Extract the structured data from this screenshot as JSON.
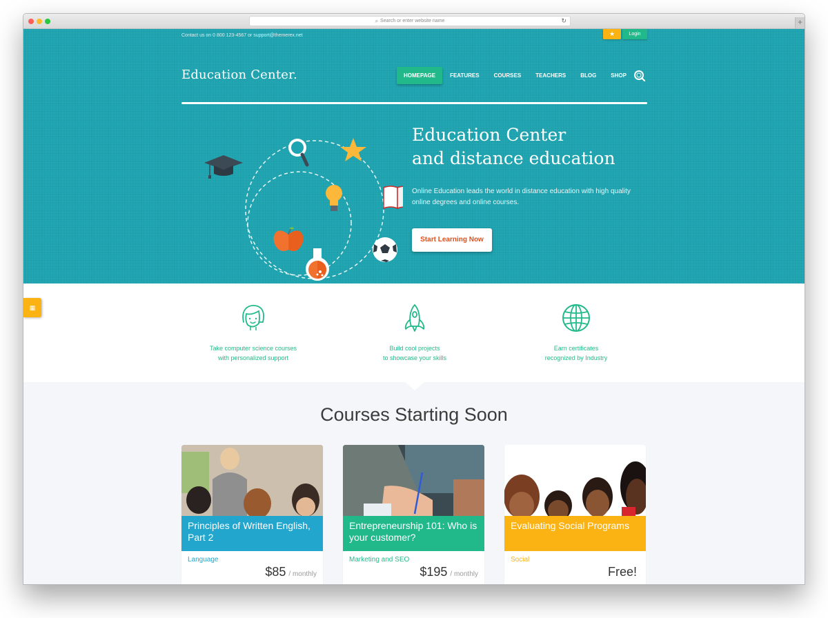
{
  "browser": {
    "url_placeholder": "Search or enter website name",
    "search_glyph": "⌕",
    "reload_glyph": "↻",
    "new_tab_glyph": "+"
  },
  "topbar": {
    "contact": "Contact us on 0 800 123-4567 or support@themerex.net",
    "fav_glyph": "★",
    "login": "Login"
  },
  "header": {
    "logo": "Education Center.",
    "nav": [
      {
        "label": "HOMEPAGE",
        "active": true
      },
      {
        "label": "FEATURES",
        "active": false
      },
      {
        "label": "COURSES",
        "active": false
      },
      {
        "label": "TEACHERS",
        "active": false
      },
      {
        "label": "BLOG",
        "active": false
      },
      {
        "label": "SHOP",
        "active": false
      }
    ]
  },
  "hero": {
    "title_line1": "Education Center",
    "title_line2": "and distance education",
    "text": "Online Education leads the world in distance education with high quality online degrees and online courses.",
    "cta": "Start Learning Now",
    "illustration_icons": [
      "graduation-cap",
      "magnifier",
      "star",
      "book",
      "light-bulb",
      "apple",
      "soccer-ball",
      "flask"
    ]
  },
  "features": [
    {
      "icon": "girl-face",
      "line1": "Take computer science courses",
      "line2": "with personalized support"
    },
    {
      "icon": "rocket",
      "line1": "Build cool projects",
      "line2": "to showcase your skills"
    },
    {
      "icon": "globe",
      "line1": "Earn certificates",
      "line2": "recognized by Industry"
    }
  ],
  "side_tab_glyph": "▦",
  "courses": {
    "title": "Courses Starting Soon",
    "items": [
      {
        "title": "Principles of Written English, Part 2",
        "category": "Language",
        "price": "$85",
        "period": "/  monthly",
        "color": "#22a6cd"
      },
      {
        "title": "Entrepreneurship 101: Who is your customer?",
        "category": "Marketing and SEO",
        "price": "$195",
        "period": "/  monthly",
        "color": "#21b989"
      },
      {
        "title": "Evaluating Social Programs",
        "category": "Social",
        "price": "Free!",
        "period": "",
        "color": "#fbb314"
      }
    ]
  },
  "colors": {
    "hero_bg": "#1ea3b0",
    "accent_green": "#21b989",
    "accent_yellow": "#fbb314",
    "accent_blue": "#22a6cd",
    "cta_text": "#e04e1a"
  }
}
